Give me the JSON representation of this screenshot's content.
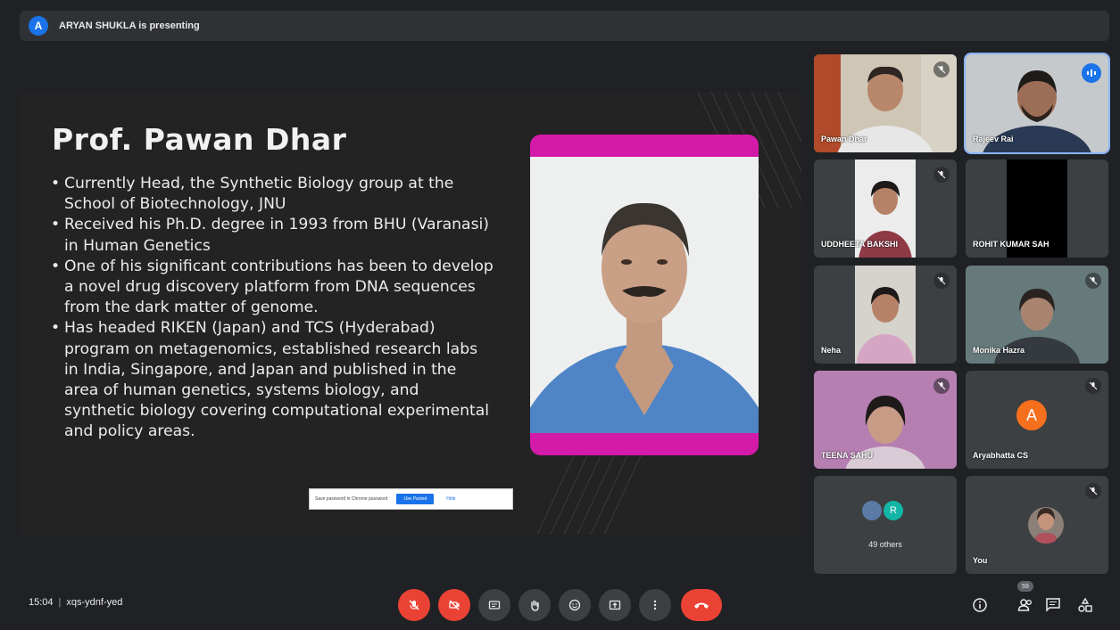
{
  "presenter_bar": {
    "avatar_letter": "A",
    "text": "ARYAN SHUKLA is presenting"
  },
  "slide": {
    "title": "Prof. Pawan Dhar",
    "bullets": [
      "Currently Head, the Synthetic Biology group at the School of Biotechnology, JNU",
      "Received his Ph.D. degree in 1993 from BHU (Varanasi) in Human Genetics",
      "One of his significant contributions has been to develop a novel drug discovery platform from DNA sequences from the dark matter of genome.",
      "Has headed RIKEN (Japan) and TCS (Hyderabad) program on metagenomics, established research labs in India, Singapore, and Japan and published in the area of human genetics, systems biology, and synthetic biology covering computational experimental and policy areas."
    ],
    "frame_color": "#d41aa8",
    "popup": {
      "text": "Save password in Chrome password",
      "button": "Use Pasted",
      "link": "Hide"
    }
  },
  "participants": [
    {
      "name": "Pawan Dhar",
      "mic": "muted",
      "active": false
    },
    {
      "name": "Rajeev Rai",
      "mic": "speaking",
      "active": true
    },
    {
      "name": "UDDHEETA BAKSHI",
      "mic": "muted",
      "active": false
    },
    {
      "name": "ROHIT KUMAR SAH",
      "mic": "none",
      "active": false
    },
    {
      "name": "Neha",
      "mic": "muted",
      "active": false
    },
    {
      "name": "Monika Hazra",
      "mic": "muted",
      "active": false
    },
    {
      "name": "TEENA SAHU",
      "mic": "muted",
      "active": false
    },
    {
      "name": "Aryabhatta CS",
      "mic": "muted",
      "active": false,
      "avatar_letter": "A",
      "avatar_color": "#f56f1c"
    },
    {
      "name": "49 others",
      "mic": "none",
      "active": false,
      "avatar_letter": "R"
    },
    {
      "name": "You",
      "mic": "muted",
      "active": false
    }
  ],
  "bottom_bar": {
    "time": "15:04",
    "meeting_code": "xqs-ydnf-yed",
    "people_count": "59",
    "controls": [
      "mic-off",
      "camera-off",
      "captions",
      "raise-hand",
      "emoji",
      "present-screen",
      "more-options",
      "leave-call"
    ],
    "right_controls": [
      "meeting-details",
      "people",
      "chat",
      "activities"
    ]
  },
  "colors": {
    "background": "#202124",
    "tile": "#3c4043",
    "danger": "#ea4335",
    "accent": "#1a73e8",
    "active_border": "#8ab4f8"
  }
}
